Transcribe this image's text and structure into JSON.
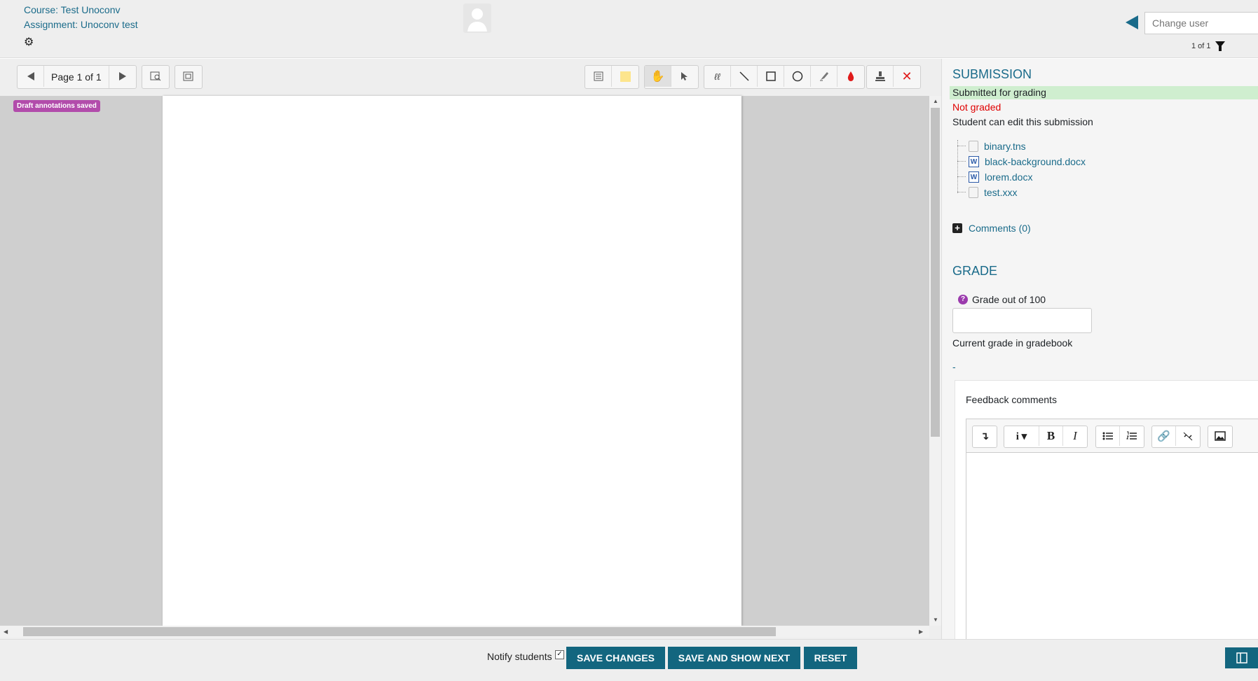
{
  "header": {
    "course": "Course: Test Unoconv",
    "assignment": "Assignment: Unoconv test",
    "change_user_placeholder": "Change user",
    "user_count": "1 of 1"
  },
  "toolbar": {
    "page_label": "Page 1 of 1"
  },
  "viewer": {
    "draft_badge": "Draft annotations saved"
  },
  "submission": {
    "heading": "SUBMISSION",
    "status": "Submitted for grading",
    "grading_status": "Not graded",
    "edit_status": "Student can edit this submission",
    "files": [
      {
        "name": "binary.tns",
        "type": "generic"
      },
      {
        "name": "black-background.docx",
        "type": "word"
      },
      {
        "name": "lorem.docx",
        "type": "word"
      },
      {
        "name": "test.xxx",
        "type": "generic"
      }
    ],
    "comments_link": "Comments (0)"
  },
  "grade": {
    "heading": "GRADE",
    "label": "Grade out of 100",
    "value": "",
    "gradebook_label": "Current grade in gradebook",
    "gradebook_value": "-",
    "feedback_label": "Feedback comments"
  },
  "footer": {
    "notify_label": "Notify students",
    "notify_checked": true,
    "save_changes": "SAVE CHANGES",
    "save_and_next": "SAVE AND SHOW NEXT",
    "reset": "RESET"
  },
  "colors": {
    "accent": "#13667f",
    "link": "#1a6b8a",
    "badge": "#b24cab",
    "not_graded": "#e00000",
    "submitted_bg": "#cfeecf"
  }
}
